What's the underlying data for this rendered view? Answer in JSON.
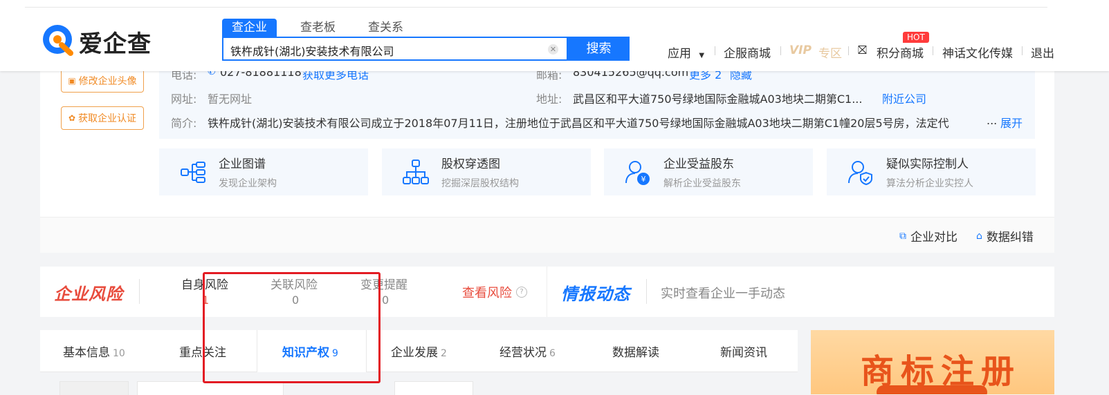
{
  "brand": {
    "name": "爱企查"
  },
  "search": {
    "tabs": [
      {
        "label": "查企业",
        "active": true
      },
      {
        "label": "查老板",
        "active": false
      },
      {
        "label": "查关系",
        "active": false
      }
    ],
    "query": "铁杵成针(湖北)安装技术有限公司",
    "button": "搜索"
  },
  "nav": {
    "apps": "应用",
    "enterprise_mall": "企服商城",
    "vip_prefix": "VIP",
    "vip_zone": "专区",
    "hot": "HOT",
    "points_mall": "积分商城",
    "user": "神话文化传媒",
    "logout": "退出"
  },
  "company": {
    "actions": [
      "修改企业头像",
      "获取企业认证"
    ],
    "phone_label": "电话:",
    "phone": "027-81881118",
    "phone_more": "获取更多电话",
    "email_label": "邮箱:",
    "email": "830415265@qq.com",
    "email_more": "更多 2",
    "email_hide": "隐藏",
    "website_label": "网址:",
    "website": "暂无网址",
    "address_label": "地址:",
    "address": "武昌区和平大道750号绿地国际金融城A03地块二期第C1...",
    "nearby": "附近公司",
    "intro_label": "简介:",
    "intro": "铁杵成针(湖北)安装技术有限公司成立于2018年07月11日，注册地位于武昌区和平大道750号绿地国际金融城A03地块二期第C1幢20层5号房，法定代",
    "intro_ellipsis": "...",
    "expand": "展开"
  },
  "features": [
    {
      "title": "企业图谱",
      "sub": "发现企业架构",
      "icon": "org-chart-icon"
    },
    {
      "title": "股权穿透图",
      "sub": "挖掘深层股权结构",
      "icon": "equity-tree-icon"
    },
    {
      "title": "企业受益股东",
      "sub": "解析企业受益股东",
      "icon": "beneficiary-icon"
    },
    {
      "title": "疑似实际控制人",
      "sub": "算法分析企业实控人",
      "icon": "controller-icon"
    }
  ],
  "tools": {
    "compare": "企业对比",
    "report_error": "数据纠错"
  },
  "risk": {
    "logo": "企业风险",
    "items": [
      {
        "label": "自身风险",
        "count": "1"
      },
      {
        "label": "关联风险",
        "count": "0"
      },
      {
        "label": "变更提醒",
        "count": "0"
      }
    ],
    "view": "查看风险",
    "intel_logo": "情报动态",
    "intel_text": "实时查看企业一手动态"
  },
  "tabs": [
    {
      "label": "基本信息",
      "count": "10",
      "active": false
    },
    {
      "label": "重点关注",
      "count": "",
      "active": false
    },
    {
      "label": "知识产权",
      "count": "9",
      "active": true
    },
    {
      "label": "企业发展",
      "count": "2",
      "active": false
    },
    {
      "label": "经营状况",
      "count": "6",
      "active": false
    },
    {
      "label": "数据解读",
      "count": "",
      "active": false
    },
    {
      "label": "新闻资讯",
      "count": "",
      "active": false
    }
  ],
  "ad": {
    "text": "商标注册"
  },
  "colors": {
    "primary": "#1677ff",
    "risk": "#e84c3d",
    "accent": "#f08a24",
    "annotation": "#e31b23"
  }
}
